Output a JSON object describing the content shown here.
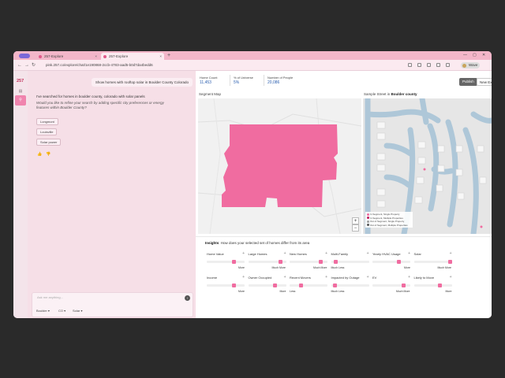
{
  "browser": {
    "tabs": [
      {
        "label": "257-Explore"
      },
      {
        "label": "257-Explore"
      }
    ],
    "new_tab": "+",
    "url": "pink.257.co/explore/chat/1e190868-2ccb-4783-aad5-b0d7da4bedd6",
    "profile": "Wave",
    "win_min": "—",
    "win_max": "▢",
    "win_close": "✕",
    "nav_back": "←",
    "nav_forward": "→",
    "nav_reload": "↻",
    "tab_close": "×"
  },
  "rail": {
    "logo": "257",
    "avatar": "SC"
  },
  "chat": {
    "user_message": "Show homes with rooftop solar in Boulder County Colorado",
    "assistant_text": "I've searched for homes in boulder county, colorado with solar panels",
    "assistant_followup": "Would you like to refine your search by adding specific city preferences or energy features within Boulder County?",
    "chips": [
      "Longmont",
      "Louisville",
      "Solar power"
    ],
    "thumbs_up": "👍",
    "thumbs_down": "👎",
    "input_placeholder": "Ask me anything...",
    "send_icon": "↑",
    "selectors": [
      "Boulder ▾",
      "CO ▾",
      "Solar ▾"
    ]
  },
  "stats": [
    {
      "label": "Home Count",
      "value": "11,453"
    },
    {
      "label": "% of Universe",
      "value": "5%"
    },
    {
      "label": "Number of People",
      "value": "20,086"
    }
  ],
  "actions": {
    "publish": "Publish",
    "new_explore": "New Explore"
  },
  "segment_map": {
    "title": "Segment Map",
    "zoom_in": "+",
    "zoom_out": "−",
    "legend": [
      {
        "label": "In Segment, Single Property",
        "color": "#f06ca0"
      },
      {
        "label": "In Segment, Multiple Properties",
        "color": "#c2185b"
      },
      {
        "label": "Out of Segment, Single Property",
        "color": "#9e9e9e"
      },
      {
        "label": "Out of Segment, Multiple Properties",
        "color": "#555555"
      }
    ],
    "region_color": "#f06ca0"
  },
  "street": {
    "title_prefix": "Sample Street in",
    "title_place": "Boulder county"
  },
  "insights": {
    "title_bold": "Insights",
    "title_rest": ": How does your selected set of homes differ from its area",
    "items": [
      {
        "name": "Home Value",
        "caption": "More",
        "level": 0.72
      },
      {
        "name": "Large Homes",
        "caption": "Much More",
        "level": 0.85
      },
      {
        "name": "New Homes",
        "caption": "Much More",
        "level": 0.82
      },
      {
        "name": "Multi-Family",
        "caption": "Much Less",
        "level": 0.12
      },
      {
        "name": "Yearly HVAC Usage",
        "caption": "More",
        "level": 0.7
      },
      {
        "name": "Solar",
        "caption": "Much More",
        "level": 0.95
      },
      {
        "name": "Income",
        "caption": "More",
        "level": 0.72
      },
      {
        "name": "Owner Occupied",
        "caption": "More",
        "level": 0.7
      },
      {
        "name": "Recent Movers",
        "caption": "Less",
        "level": 0.3
      },
      {
        "name": "Impacted by Outage",
        "caption": "Much Less",
        "level": 0.1
      },
      {
        "name": "EV",
        "caption": "Much More",
        "level": 0.82
      },
      {
        "name": "Likely to Move",
        "caption": "More",
        "level": 0.68
      }
    ],
    "plus": "+"
  }
}
